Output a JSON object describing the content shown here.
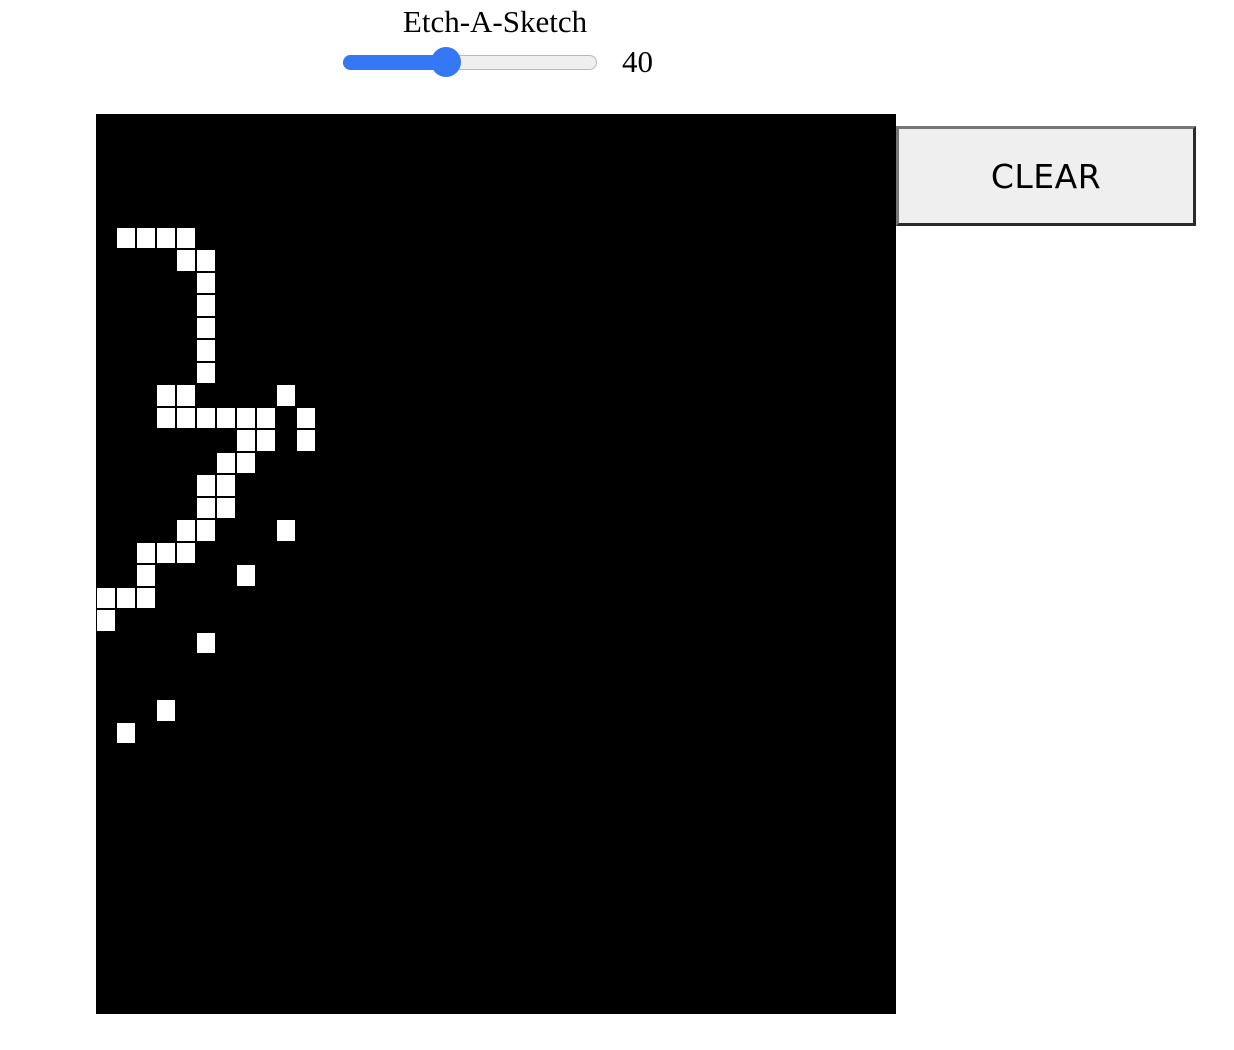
{
  "app": {
    "title": "Etch-A-Sketch"
  },
  "grid_size_slider": {
    "min": 1,
    "max": 100,
    "value": 40,
    "value_label": "40",
    "accent_color": "#3478f6"
  },
  "controls": {
    "clear_label": "CLEAR"
  },
  "board": {
    "columns": 40,
    "rows": 40,
    "background_color": "#000000",
    "ink_color": "#ffffff",
    "painted_cells": [
      [
        1,
        5
      ],
      [
        2,
        5
      ],
      [
        3,
        5
      ],
      [
        4,
        5
      ],
      [
        4,
        6
      ],
      [
        5,
        6
      ],
      [
        5,
        7
      ],
      [
        5,
        8
      ],
      [
        5,
        9
      ],
      [
        5,
        10
      ],
      [
        5,
        11
      ],
      [
        3,
        12
      ],
      [
        4,
        12
      ],
      [
        9,
        12
      ],
      [
        3,
        13
      ],
      [
        4,
        13
      ],
      [
        5,
        13
      ],
      [
        6,
        13
      ],
      [
        7,
        13
      ],
      [
        8,
        13
      ],
      [
        10,
        13
      ],
      [
        7,
        14
      ],
      [
        8,
        14
      ],
      [
        10,
        14
      ],
      [
        6,
        15
      ],
      [
        7,
        15
      ],
      [
        5,
        16
      ],
      [
        6,
        16
      ],
      [
        5,
        17
      ],
      [
        6,
        17
      ],
      [
        4,
        18
      ],
      [
        5,
        18
      ],
      [
        9,
        18
      ],
      [
        2,
        19
      ],
      [
        3,
        19
      ],
      [
        4,
        19
      ],
      [
        2,
        20
      ],
      [
        7,
        20
      ],
      [
        0,
        21
      ],
      [
        1,
        21
      ],
      [
        2,
        21
      ],
      [
        0,
        22
      ],
      [
        5,
        23
      ],
      [
        3,
        26
      ],
      [
        1,
        27
      ]
    ]
  }
}
